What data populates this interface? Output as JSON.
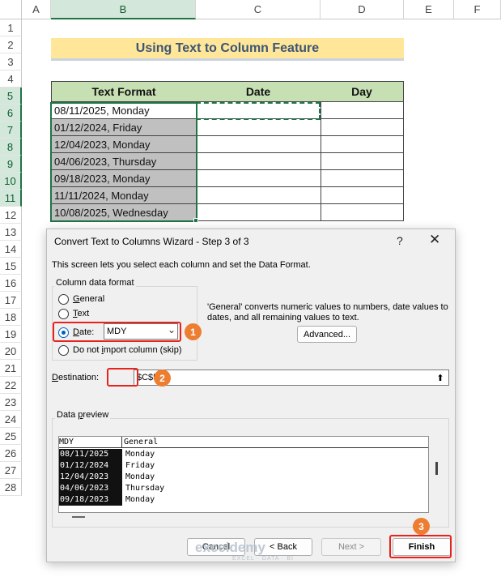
{
  "spreadsheet": {
    "columns": [
      "A",
      "B",
      "C",
      "D",
      "E",
      "F"
    ],
    "rows": [
      "1",
      "2",
      "3",
      "4",
      "5",
      "6",
      "7",
      "8",
      "9",
      "10",
      "11",
      "12",
      "13",
      "14",
      "15",
      "16",
      "17",
      "18",
      "19",
      "20",
      "21",
      "22",
      "23",
      "24",
      "25",
      "26",
      "27",
      "28"
    ],
    "title": "Using Text to Column Feature",
    "headers": {
      "text_format": "Text Format",
      "date": "Date",
      "day": "Day"
    },
    "values": [
      "08/11/2025, Monday",
      "01/12/2024, Friday",
      "12/04/2023, Monday",
      "04/06/2023, Thursday",
      "09/18/2023, Monday",
      "11/11/2024, Monday",
      "10/08/2025, Wednesday"
    ],
    "selected_column": "B",
    "selected_rows": [
      "5",
      "6",
      "7",
      "8",
      "9",
      "10",
      "11"
    ]
  },
  "dialog": {
    "title": "Convert Text to Columns Wizard - Step 3 of 3",
    "help_label": "?",
    "close_label": "✕",
    "intro": "This screen lets you select each column and set the Data Format.",
    "column_format_label": "Column data format",
    "options": {
      "general": {
        "first": "G",
        "rest": "eneral"
      },
      "text": {
        "first": "T",
        "rest": "ext"
      },
      "date": {
        "first": "D",
        "rest": "ate:"
      },
      "skip": {
        "before": "Do not ",
        "key": "i",
        "rest": "mport column (skip)"
      }
    },
    "date_format_value": "MDY",
    "info_text": "'General' converts numeric values to numbers, date values to dates, and all remaining values to text.",
    "advanced_label": "Advanced...",
    "destination_label": {
      "key": "D",
      "rest": "estination:"
    },
    "destination_value": "$C$5",
    "preview_label": {
      "before": "Data ",
      "key": "p",
      "rest": "review"
    },
    "preview": {
      "headers": [
        "MDY",
        "General"
      ],
      "col1": [
        "08/11/2025",
        "01/12/2024",
        "12/04/2023",
        "04/06/2023",
        "09/18/2023"
      ],
      "col2": [
        "Monday",
        "Friday",
        "Monday",
        "Thursday",
        "Monday"
      ]
    },
    "buttons": {
      "cancel": "Cancel",
      "back": "< Back",
      "next": "Next >",
      "finish": "Finish"
    },
    "badges": [
      "1",
      "2",
      "3"
    ]
  },
  "watermark": {
    "name": "exceldemy",
    "tagline": "EXCEL · DATA · BI"
  },
  "colors": {
    "accent_green": "#217346",
    "highlight_red": "#e8221c",
    "badge_orange": "#ed7d31",
    "title_fill": "#ffe699",
    "header_fill": "#c6e0b4"
  }
}
